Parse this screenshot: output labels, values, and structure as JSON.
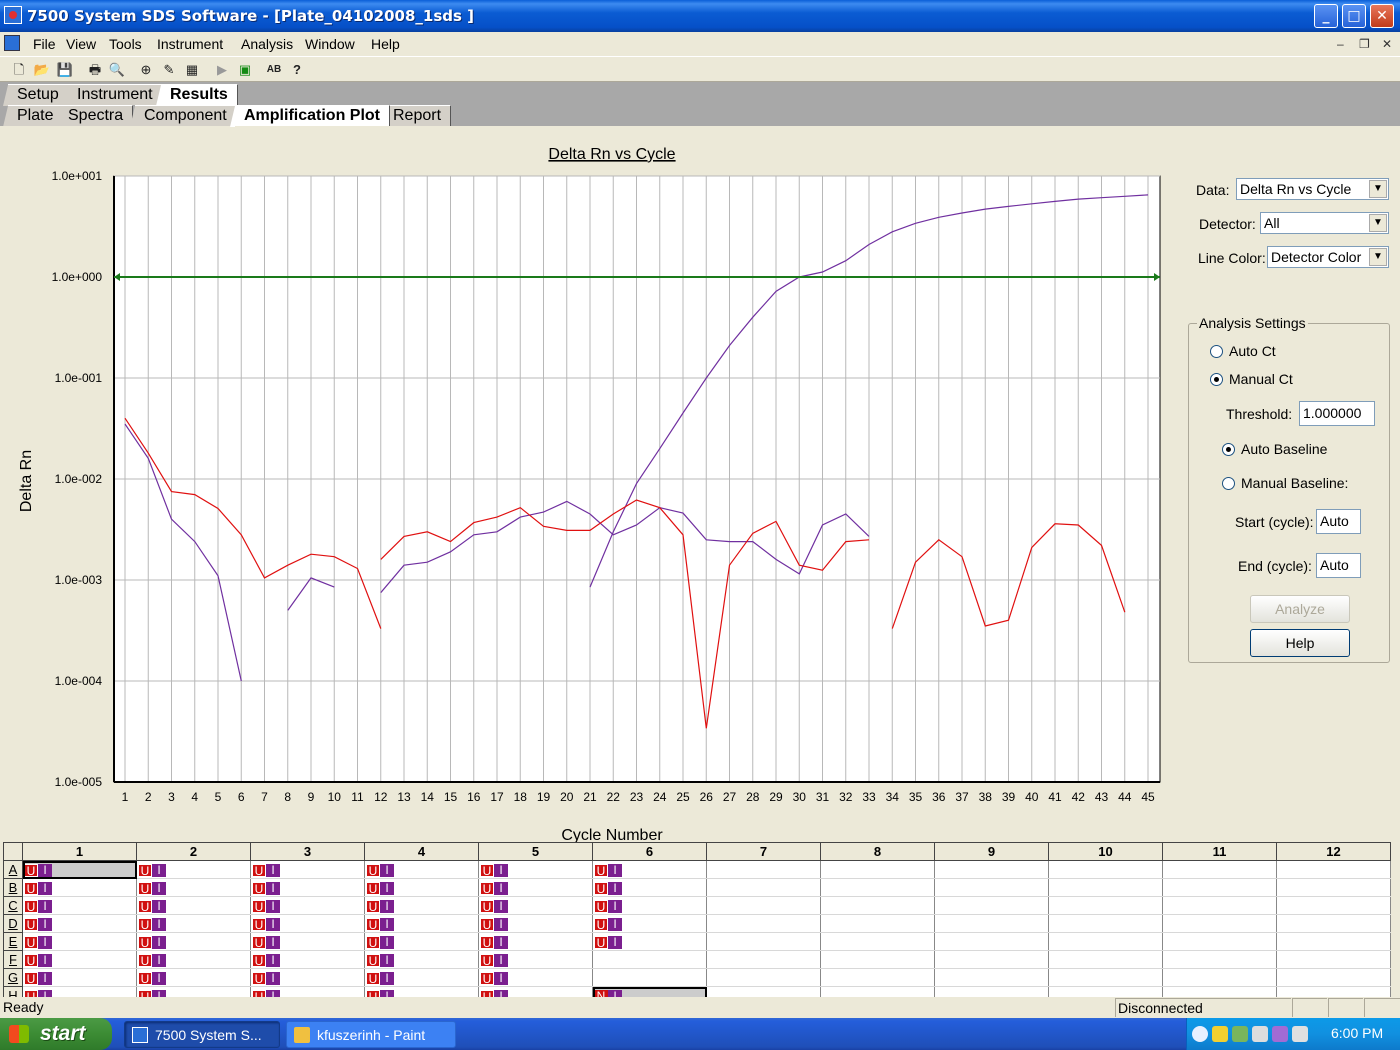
{
  "window": {
    "title": "7500 System SDS Software - [Plate_04102008_1sds ]",
    "btn_min": "_",
    "btn_max": "□",
    "btn_close": "✕"
  },
  "menu": [
    "File",
    "View",
    "Tools",
    "Instrument",
    "Analysis",
    "Window",
    "Help"
  ],
  "mdi_controls": {
    "min": "–",
    "restore": "❐",
    "close": "✕"
  },
  "tabs_top": [
    "Setup",
    "Instrument",
    "Results"
  ],
  "tabs_bottom": [
    "Plate",
    "Spectra",
    "Component",
    "Amplification Plot",
    "Report"
  ],
  "side": {
    "data_label": "Data:",
    "data_value": "Delta Rn vs Cycle",
    "detector_label": "Detector:",
    "detector_value": "All",
    "line_color_label": "Line Color:",
    "line_color_value": "Detector Color",
    "analysis_title": "Analysis Settings",
    "auto_ct": "Auto Ct",
    "manual_ct": "Manual Ct",
    "threshold_label": "Threshold:",
    "threshold_value": "1.000000",
    "auto_baseline": "Auto Baseline",
    "manual_baseline": "Manual Baseline:",
    "start_label": "Start (cycle):",
    "start_value": "Auto",
    "end_label": "End (cycle):",
    "end_value": "Auto",
    "analyze_btn": "Analyze",
    "help_btn": "Help"
  },
  "chart_data": {
    "type": "line",
    "title": "Delta Rn vs Cycle",
    "xlabel": "Cycle Number",
    "ylabel": "Delta Rn",
    "y_scale": "log",
    "ylim": [
      1e-05,
      10
    ],
    "xlim": [
      1,
      45
    ],
    "y_tick_labels": [
      "1.0e+001",
      "1.0e+000",
      "1.0e-001",
      "1.0e-002",
      "1.0e-003",
      "1.0e-004",
      "1.0e-005"
    ],
    "x_ticks": [
      1,
      2,
      3,
      4,
      5,
      6,
      7,
      8,
      9,
      10,
      11,
      12,
      13,
      14,
      15,
      16,
      17,
      18,
      19,
      20,
      21,
      22,
      23,
      24,
      25,
      26,
      27,
      28,
      29,
      30,
      31,
      32,
      33,
      34,
      35,
      36,
      37,
      38,
      39,
      40,
      41,
      42,
      43,
      44,
      45
    ],
    "threshold": 1.0,
    "threshold_color": "#1a7a1a",
    "series": [
      {
        "color": "#7030a0",
        "segments": [
          [
            [
              1,
              0.035
            ],
            [
              2,
              0.016
            ],
            [
              3,
              0.004
            ],
            [
              4,
              0.0024
            ],
            [
              5,
              0.0011
            ],
            [
              6,
              0.0001
            ]
          ],
          [
            [
              8,
              0.0005
            ],
            [
              9,
              0.00105
            ],
            [
              10,
              0.00085
            ]
          ],
          [
            [
              12,
              0.00075
            ],
            [
              13,
              0.0014
            ],
            [
              14,
              0.0015
            ],
            [
              15,
              0.0019
            ],
            [
              16,
              0.0028
            ],
            [
              17,
              0.003
            ],
            [
              18,
              0.0042
            ],
            [
              19,
              0.0047
            ],
            [
              20,
              0.006
            ],
            [
              21,
              0.0045
            ],
            [
              22,
              0.0028
            ],
            [
              23,
              0.0035
            ],
            [
              24,
              0.0052
            ],
            [
              25,
              0.0046
            ],
            [
              26,
              0.0025
            ],
            [
              27,
              0.0024
            ],
            [
              28,
              0.0024
            ],
            [
              29,
              0.0016
            ],
            [
              30,
              0.00115
            ],
            [
              31,
              0.0035
            ],
            [
              32,
              0.0045
            ],
            [
              33,
              0.0027
            ]
          ],
          [
            [
              21,
              0.00085
            ],
            [
              22,
              0.003
            ],
            [
              23,
              0.009
            ],
            [
              24,
              0.02
            ],
            [
              25,
              0.045
            ],
            [
              26,
              0.1
            ],
            [
              27,
              0.21
            ],
            [
              28,
              0.4
            ],
            [
              29,
              0.72
            ],
            [
              30,
              1.0
            ],
            [
              31,
              1.12
            ],
            [
              32,
              1.45
            ],
            [
              33,
              2.1
            ],
            [
              34,
              2.8
            ],
            [
              35,
              3.4
            ],
            [
              36,
              3.9
            ],
            [
              37,
              4.3
            ],
            [
              38,
              4.7
            ],
            [
              39,
              5.0
            ],
            [
              40,
              5.3
            ],
            [
              41,
              5.6
            ],
            [
              42,
              5.9
            ],
            [
              43,
              6.1
            ],
            [
              44,
              6.3
            ],
            [
              45,
              6.5
            ]
          ]
        ]
      },
      {
        "color": "#e01010",
        "segments": [
          [
            [
              1,
              0.04
            ],
            [
              2,
              0.018
            ],
            [
              3,
              0.0075
            ],
            [
              4,
              0.007
            ],
            [
              5,
              0.0051
            ],
            [
              6,
              0.0028
            ],
            [
              7,
              0.00105
            ],
            [
              8,
              0.0014
            ],
            [
              9,
              0.0018
            ],
            [
              10,
              0.0017
            ],
            [
              11,
              0.0013
            ],
            [
              12,
              0.00033
            ]
          ],
          [
            [
              12,
              0.0016
            ],
            [
              13,
              0.0027
            ],
            [
              14,
              0.003
            ],
            [
              15,
              0.0024
            ],
            [
              16,
              0.0037
            ],
            [
              17,
              0.0042
            ],
            [
              18,
              0.0052
            ],
            [
              19,
              0.0034
            ],
            [
              20,
              0.0031
            ],
            [
              21,
              0.0031
            ],
            [
              22,
              0.0045
            ],
            [
              23,
              0.0062
            ],
            [
              24,
              0.0052
            ],
            [
              25,
              0.0028
            ],
            [
              26,
              3.4e-05
            ],
            [
              27,
              0.0014
            ],
            [
              28,
              0.0029
            ],
            [
              29,
              0.0038
            ],
            [
              30,
              0.0014
            ],
            [
              31,
              0.00125
            ],
            [
              32,
              0.0024
            ],
            [
              33,
              0.0025
            ]
          ],
          [
            [
              34,
              0.00033
            ],
            [
              35,
              0.0015
            ],
            [
              36,
              0.0025
            ],
            [
              37,
              0.0017
            ],
            [
              38,
              0.00035
            ],
            [
              39,
              0.0004
            ],
            [
              40,
              0.0021
            ],
            [
              41,
              0.0036
            ],
            [
              42,
              0.0035
            ],
            [
              43,
              0.0022
            ],
            [
              44,
              0.00048
            ]
          ]
        ]
      }
    ]
  },
  "plate": {
    "columns": [
      "1",
      "2",
      "3",
      "4",
      "5",
      "6",
      "7",
      "8",
      "9",
      "10",
      "11",
      "12"
    ],
    "rows": [
      "A",
      "B",
      "C",
      "D",
      "E",
      "F",
      "G",
      "H"
    ],
    "chip_u": "U",
    "chip_i": "I",
    "chip_n": "N",
    "filled_through_col": {
      "A": 6,
      "B": 6,
      "C": 6,
      "D": 6,
      "E": 6,
      "F": 5,
      "G": 5,
      "H": 5
    },
    "ntc_well": "H6",
    "selected_well": "A1"
  },
  "status": {
    "left": "Ready",
    "connection": "Disconnected"
  },
  "taskbar": {
    "start": "start",
    "tasks": [
      "7500 System S...",
      "kfuszerinh - Paint"
    ],
    "clock": "6:00 PM"
  }
}
